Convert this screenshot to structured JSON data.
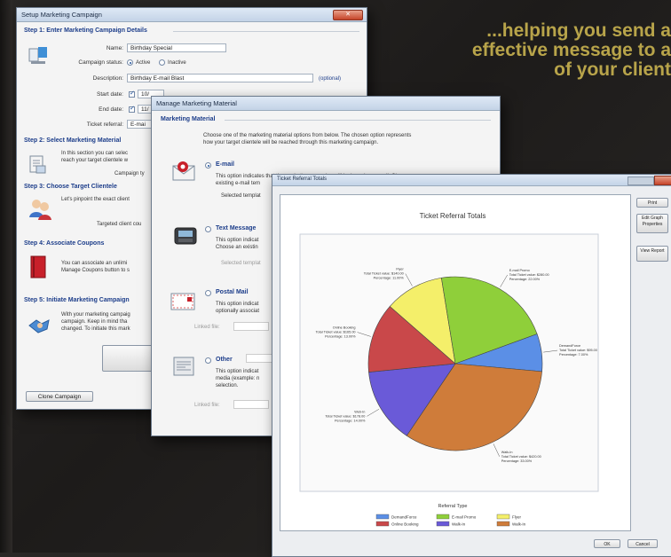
{
  "tagline": {
    "line1": "...helping you send a",
    "line2": "effective message to a",
    "line3": "of your client"
  },
  "setup_window": {
    "title": "Setup Marketing Campaign",
    "close": "✕",
    "step1": "Step 1: Enter Marketing Campaign Details",
    "name_label": "Name:",
    "name_value": "Birthday Special",
    "status_label": "Campaign status:",
    "status_active": "Active",
    "status_inactive": "Inactive",
    "description_label": "Description:",
    "description_value": "Birthday E-mail Blast",
    "optional": "(optional)",
    "start_label": "Start date:",
    "start_value": "10/",
    "end_label": "End date:",
    "end_value": "11/",
    "referral_label": "Ticket referral:",
    "referral_value": "E-mai",
    "step2": "Step 2: Select Marketing Material",
    "step2_text1": "In this section you can selec",
    "step2_text2": "reach your target clientele w",
    "campaign_type": "Campaign ty",
    "step3": "Step 3: Choose Target Clientele",
    "step3_text": "Let's pinpoint the exact client",
    "targeted": "Targeted client cou",
    "step4": "Step 4: Associate Coupons",
    "step4_text1": "You can associate an unlimi",
    "step4_text2": "Manage Coupons button to s",
    "step5": "Step 5: Initiate Marketing Campaign",
    "step5_text1": "With your marketing campaig",
    "step5_text2": "campaign. Keep in mind tha",
    "step5_text3": "changed. To initiate this mark",
    "clone_button": "Clone Campaign"
  },
  "material_window": {
    "title": "Manage Marketing Material",
    "section": "Marketing Material",
    "intro1": "Choose one of the marketing material options from below. The chosen option represents",
    "intro2": "how your target clientele will be reached through this marketing campaign.",
    "email_label": "E-mail",
    "email_text1": "This option indicates that the marketing campaign will be based on e-mail. Choose an",
    "email_text2": "existing e-mail tem",
    "email_selected": "Selected templat",
    "text_label": "Text Message",
    "text_text1": "This option indicat",
    "text_text2": "Choose an existin",
    "text_selected": "Selected templat",
    "postal_label": "Postal Mail",
    "postal_text1": "This option indicat",
    "postal_text2": "optionally associat",
    "postal_linked": "Linked file:",
    "other_label": "Other",
    "other_text1": "This option indicat",
    "other_text2": "media (example: n",
    "other_text3": "selection.",
    "other_linked": "Linked file:"
  },
  "referral_window": {
    "title": "Ticket Referral Totals",
    "side_print": "Print",
    "side_edit": "Edit Graph Properties",
    "side_view": "View Report",
    "ok": "OK",
    "cancel": "Cancel"
  },
  "chart_data": {
    "type": "pie",
    "title": "Ticket Referral Totals",
    "legend_title": "Referral Type",
    "legend_position": "bottom",
    "slices": [
      {
        "name": "DemandForce",
        "value": 7.0,
        "color": "#5b8fe6",
        "callout": [
          "DemandForce",
          "Total Ticket value: $95.00",
          "Percentage: 7.00%"
        ]
      },
      {
        "name": "Walk-In",
        "value": 33.0,
        "color": "#cf7c3a",
        "callout": [
          "Walk-In",
          "Total Ticket value: $420.00",
          "Percentage: 33.00%"
        ]
      },
      {
        "name": "Web-In",
        "value": 14.0,
        "color": "#6a5ad8",
        "callout": [
          "Web-In",
          "Total Ticket value: $178.00",
          "Percentage: 14.00%"
        ]
      },
      {
        "name": "Online Booking",
        "value": 13.0,
        "color": "#c9484a",
        "callout": [
          "Online Booking",
          "Total Ticket value: $165.00",
          "Percentage: 13.00%"
        ]
      },
      {
        "name": "Flyer",
        "value": 11.0,
        "color": "#f4ef6a",
        "callout": [
          "Flyer",
          "Total Ticket value: $140.00",
          "Percentage: 11.00%"
        ]
      },
      {
        "name": "E-mail Promo",
        "value": 22.0,
        "color": "#8fcf3a",
        "callout": [
          "E-mail Promo",
          "Total Ticket value: $280.00",
          "Percentage: 22.00%"
        ]
      }
    ],
    "legend": [
      {
        "name": "DemandForce",
        "color": "#5b8fe6"
      },
      {
        "name": "E-mail Promo",
        "color": "#8fcf3a"
      },
      {
        "name": "Flyer",
        "color": "#f4ef6a"
      },
      {
        "name": "Online Booking",
        "color": "#c9484a"
      },
      {
        "name": "Walk-In",
        "color": "#6a5ad8"
      },
      {
        "name": "Walk-In",
        "color": "#cf7c3a"
      }
    ]
  }
}
